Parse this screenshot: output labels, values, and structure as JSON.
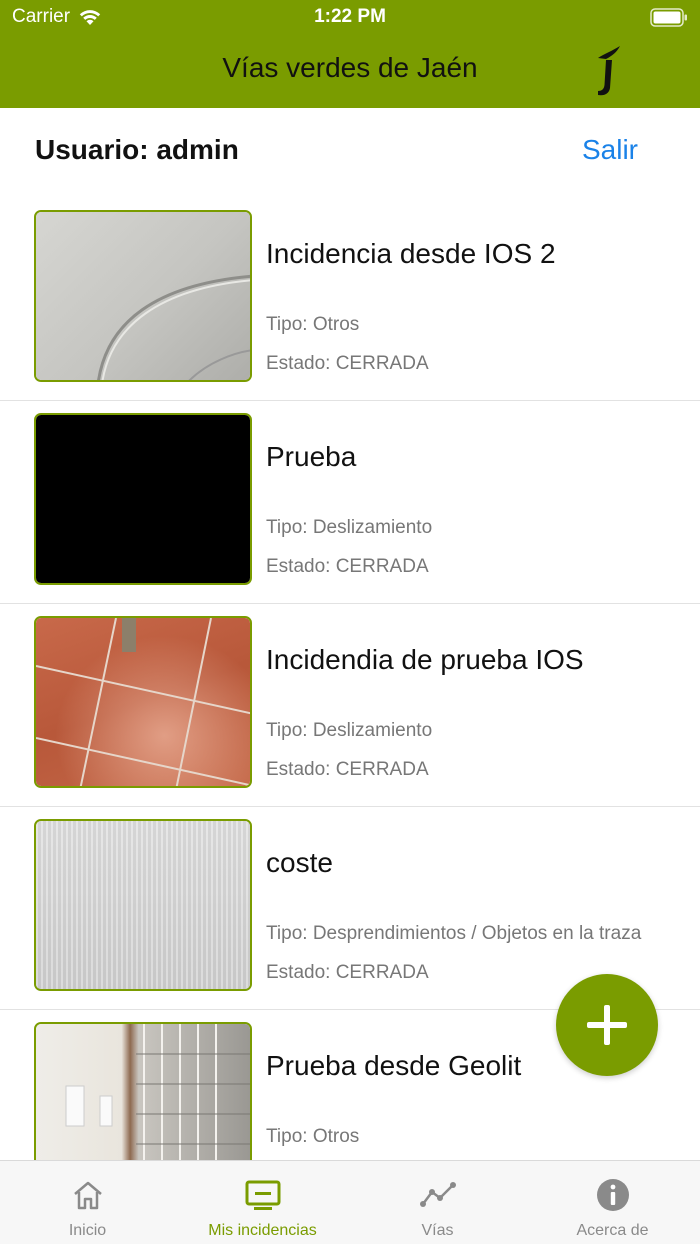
{
  "status_bar": {
    "carrier": "Carrier",
    "time": "1:22 PM"
  },
  "nav": {
    "title": "Vías verdes de Jaén",
    "logo_icon": "jaen-logo-icon"
  },
  "user": {
    "label": "Usuario: admin",
    "logout": "Salir"
  },
  "incidents": [
    {
      "title": "Incidencia desde IOS 2",
      "type": "Tipo: Otros",
      "state": "Estado: CERRADA"
    },
    {
      "title": "Prueba",
      "type": "Tipo: Deslizamiento",
      "state": "Estado: CERRADA"
    },
    {
      "title": "Incidendia de prueba IOS",
      "type": "Tipo: Deslizamiento",
      "state": "Estado: CERRADA"
    },
    {
      "title": "coste",
      "type": "Tipo: Desprendimientos / Objetos en la traza",
      "state": "Estado: CERRADA"
    },
    {
      "title": "Prueba desde Geolit",
      "type": "Tipo: Otros",
      "state": ""
    }
  ],
  "tabs": [
    {
      "label": "Inicio",
      "icon": "home-icon"
    },
    {
      "label": "Mis incidencias",
      "icon": "monitor-icon"
    },
    {
      "label": "Vías",
      "icon": "route-icon"
    },
    {
      "label": "Acerca de",
      "icon": "info-icon"
    }
  ],
  "colors": {
    "brand": "#7a9c00",
    "link": "#1a82e8",
    "tab_inactive": "#8a8a8a"
  }
}
